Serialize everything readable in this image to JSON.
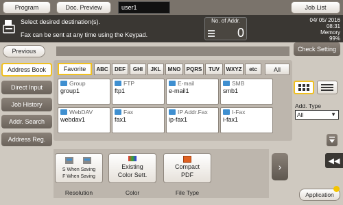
{
  "top_bar": {
    "program_label": "Program",
    "doc_preview_label": "Doc. Preview",
    "user": "user1",
    "job_list_label": "Job List"
  },
  "message": {
    "line1": "Select desired destination(s).",
    "line2": "Fax can be sent at any time using the Keypad."
  },
  "addresses": {
    "label": "No. of Addr.",
    "count": "0"
  },
  "status": {
    "date": "04/ 05/ 2016",
    "time": "08:31",
    "memory_label": "Memory",
    "memory_value": "99%"
  },
  "left_menu": {
    "previous_label": "Previous",
    "items": [
      "Address Book",
      "Direct Input",
      "Job History",
      "Addr. Search",
      "Address Reg."
    ],
    "selected": "Address Book"
  },
  "index_tabs": {
    "favorite": "Favorite",
    "letters": [
      "ABC",
      "DEF",
      "GHI",
      "JKL",
      "MNO",
      "PQRS",
      "TUV",
      "WXYZ",
      "etc"
    ],
    "all": "All"
  },
  "cards": [
    {
      "type": "Group",
      "name": "group1"
    },
    {
      "type": "FTP",
      "name": "ftp1"
    },
    {
      "type": "E-mail",
      "name": "e-mail1"
    },
    {
      "type": "SMB",
      "name": "smb1"
    },
    {
      "type": "WebDAV",
      "name": "webdav1"
    },
    {
      "type": "Fax",
      "name": "fax1"
    },
    {
      "type": "IP Addr.Fax",
      "name": "ip-fax1"
    },
    {
      "type": "I-Fax",
      "name": "i-fax1"
    }
  ],
  "right_panel": {
    "check_setting_label": "Check Setting",
    "add_type_label": "Add. Type",
    "add_type_value": "All"
  },
  "functions": [
    {
      "lines": [
        "S When Saving",
        "F When Saving"
      ],
      "label": "Resolution"
    },
    {
      "lines": [
        "Existing",
        "Color Sett."
      ],
      "label": "Color"
    },
    {
      "lines": [
        "Compact",
        "PDF"
      ],
      "label": "File Type"
    }
  ],
  "application_label": "Application",
  "colors": {
    "highlight": "#f0c020",
    "icon_blue": "#3f8fd0",
    "app_dot": "#f4c400"
  }
}
